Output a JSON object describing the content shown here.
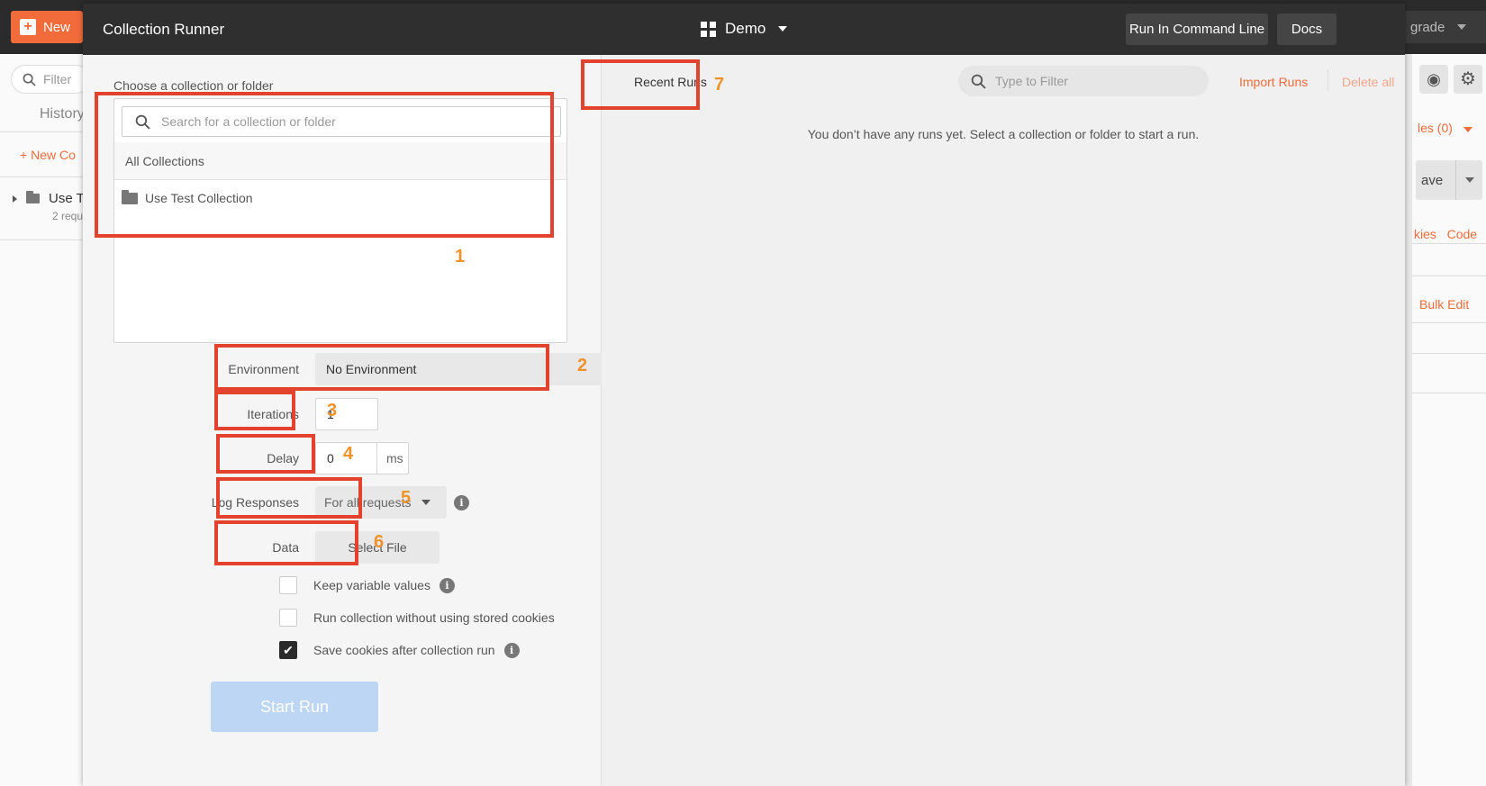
{
  "background": {
    "new_label": "New",
    "upgrade_label": "grade",
    "filter_placeholder": "Filter",
    "history_label": "History",
    "new_collection_label": "New Co",
    "collection_name": "Use T",
    "collection_sub": "2 requ",
    "variables_label": "les (0)",
    "save_label": "ave",
    "cookies_label": "kies",
    "code_label": "Code",
    "bulk_edit_label": "Bulk Edit"
  },
  "header": {
    "title": "Collection Runner",
    "workspace": "Demo",
    "run_cli_label": "Run In Command Line",
    "docs_label": "Docs"
  },
  "left": {
    "choose_label": "Choose a collection or folder",
    "search_placeholder": "Search for a collection or folder",
    "all_collections_label": "All Collections",
    "collections": [
      {
        "name": "Use Test Collection",
        "icon": "folder-icon"
      }
    ],
    "environment_label": "Environment",
    "environment_value": "No Environment",
    "iterations_label": "Iterations",
    "iterations_value": "1",
    "delay_label": "Delay",
    "delay_value": "0",
    "delay_unit": "ms",
    "log_label": "Log Responses",
    "log_value": "For all requests",
    "data_label": "Data",
    "select_file_label": "Select File",
    "options": [
      {
        "label": "Keep variable values",
        "checked": false,
        "info": true
      },
      {
        "label": "Run collection without using stored cookies",
        "checked": false,
        "info": false
      },
      {
        "label": "Save cookies after collection run",
        "checked": true,
        "info": true
      }
    ],
    "start_run_label": "Start Run"
  },
  "right": {
    "recent_runs_label": "Recent Runs",
    "filter_placeholder": "Type to Filter",
    "import_runs_label": "Import Runs",
    "delete_all_label": "Delete all",
    "empty_message": "You don’t have any runs yet. Select a collection or folder to start a run."
  },
  "annotations": [
    "1",
    "2",
    "3",
    "4",
    "5",
    "6",
    "7"
  ],
  "colors": {
    "accent": "#f26b3a",
    "annotation_box": "#e3432d",
    "annotation_number": "#f0932b",
    "header_bg": "#2f2f2f",
    "start_button": "#bcd6f3"
  }
}
